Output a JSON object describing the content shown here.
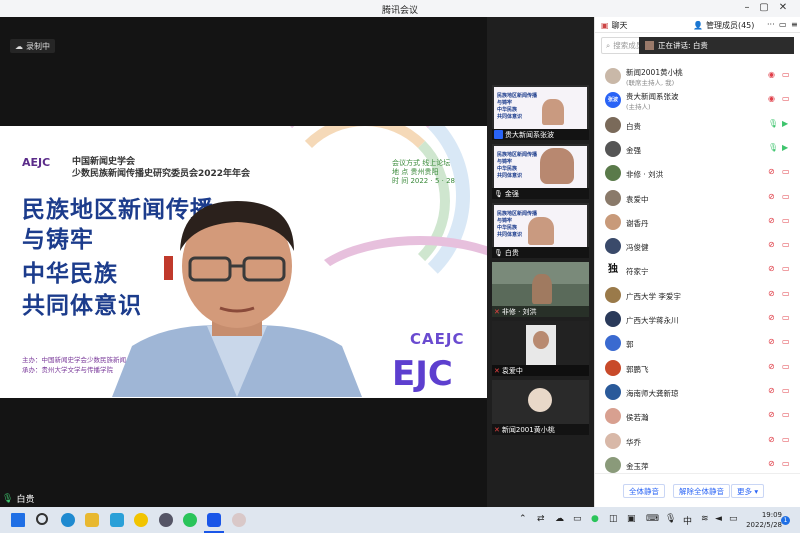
{
  "window": {
    "title": "腾讯会议"
  },
  "recording": {
    "label": "录制中"
  },
  "slide": {
    "logo": "AEJC",
    "org_line1": "中国新闻史学会",
    "org_line2": "少数民族新闻传播史研究委员会2022年年会",
    "title_lines": [
      "民族地区新闻传播",
      "与铸牢",
      "中华民族",
      "共同体意识"
    ],
    "info_lines": [
      "会议方式  线上论坛",
      "地    点  贵州贵阳",
      "时    间  2022 · 5 · 28"
    ],
    "footer_lines": [
      "主办：中国新闻史学会少数民族新闻",
      "承办：贵州大学文学与传播学院"
    ],
    "brand": "CAEJC",
    "bottom_brand": "EJC"
  },
  "main_speaker": {
    "name": "白贵"
  },
  "thumbnails": [
    {
      "name": "贵大新闻系张波",
      "kind": "slide"
    },
    {
      "name": "金强",
      "kind": "slide"
    },
    {
      "name": "白贵",
      "kind": "slide"
    },
    {
      "name": "非修 · 刘洪",
      "kind": "camera"
    },
    {
      "name": "袁爱中",
      "kind": "camera"
    },
    {
      "name": "新闻2001黄小桃",
      "kind": "camera"
    }
  ],
  "thumb_slide_text": [
    "民族地区新闻传播",
    "与铸牢",
    "中华民族",
    "共同体意识"
  ],
  "panel": {
    "tab_chat": "聊天",
    "tab_members": "管理成员(45)",
    "search_placeholder": "搜索成员",
    "speaking_prefix": "正在讲话: 白贵",
    "members": [
      {
        "name": "新闻2001黄小桃",
        "role": "(联席主持人, 我)",
        "color": "#c9b8a8",
        "mic": "muted",
        "cam": "off"
      },
      {
        "name": "贵大新闻系张波",
        "role": "(主持人)",
        "color": "#2a64f6",
        "badge": "张波",
        "mic": "muted",
        "cam": "off"
      },
      {
        "name": "白贵",
        "role": "",
        "color": "#7a6a5a",
        "mic": "on",
        "cam": "on"
      },
      {
        "name": "金强",
        "role": "",
        "color": "#555555",
        "mic": "on",
        "cam": "on"
      },
      {
        "name": "非修 · 刘洪",
        "role": "",
        "color": "#5a7a4a",
        "mic": "off",
        "cam": "off"
      },
      {
        "name": "袁爱中",
        "role": "",
        "color": "#8a7a6a",
        "mic": "off",
        "cam": "off"
      },
      {
        "name": "谢香丹",
        "role": "",
        "color": "#c89a7a",
        "mic": "off",
        "cam": "off"
      },
      {
        "name": "冯俊健",
        "role": "",
        "color": "#3a4a6a",
        "mic": "off",
        "cam": "off"
      },
      {
        "name": "符家宁",
        "role": "",
        "color": "#ffffff",
        "badge": "独",
        "mic": "off",
        "cam": "off"
      },
      {
        "name": "广西大学 李爱宇",
        "role": "",
        "color": "#9a7a4a",
        "mic": "off",
        "cam": "off"
      },
      {
        "name": "广西大学蒋永川",
        "role": "",
        "color": "#2a3a5a",
        "mic": "off",
        "cam": "off"
      },
      {
        "name": "郭",
        "role": "",
        "color": "#3a6ad0",
        "mic": "off",
        "cam": "off"
      },
      {
        "name": "郭鹏飞",
        "role": "",
        "color": "#c84a2a",
        "mic": "off",
        "cam": "off"
      },
      {
        "name": "海南师大龚新琼",
        "role": "",
        "color": "#2a5a9a",
        "mic": "off",
        "cam": "off"
      },
      {
        "name": "侯若瀚",
        "role": "",
        "color": "#d8a090",
        "mic": "off",
        "cam": "off"
      },
      {
        "name": "华乔",
        "role": "",
        "color": "#d8b8a8",
        "mic": "off",
        "cam": "off"
      },
      {
        "name": "金玉萍",
        "role": "",
        "color": "#8a9a7a",
        "mic": "off",
        "cam": "off"
      }
    ],
    "btn_mute_all": "全体静音",
    "btn_unmute_all": "解除全体静音",
    "btn_more": "更多"
  },
  "taskbar": {
    "ime": "中",
    "time": "19:09",
    "date": "2022/5/28",
    "notif_count": "1"
  }
}
